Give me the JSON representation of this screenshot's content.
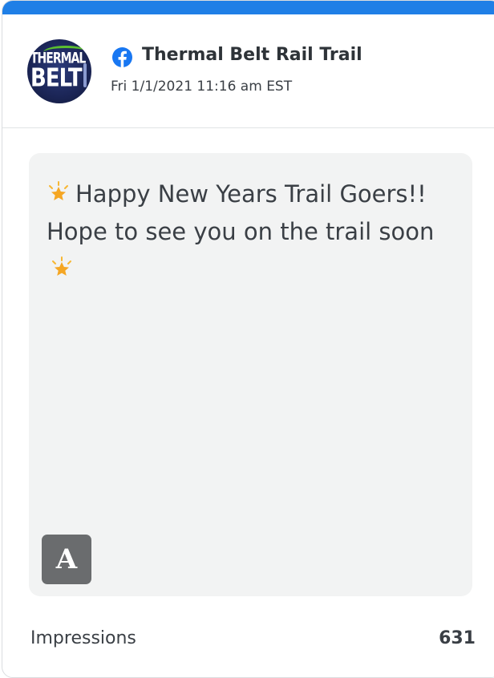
{
  "post": {
    "page_name": "Thermal Belt Rail Trail",
    "date": "Fri 1/1/2021 11:16 am EST",
    "platform_icon": "facebook-icon",
    "avatar": {
      "line1": "THERMAL",
      "line2": "BELT"
    },
    "text_main": "Happy New Years Trail Goers!! Hope to see you on the trail soon",
    "emoji": "sparkle-star-icon",
    "badge_letter": "A"
  },
  "metrics": {
    "label": "Impressions",
    "value": "631"
  },
  "colors": {
    "accent_bar": "#1f7fe6",
    "facebook": "#1877f2",
    "content_bg": "#f2f3f3",
    "badge_bg": "#6a6c6e"
  }
}
